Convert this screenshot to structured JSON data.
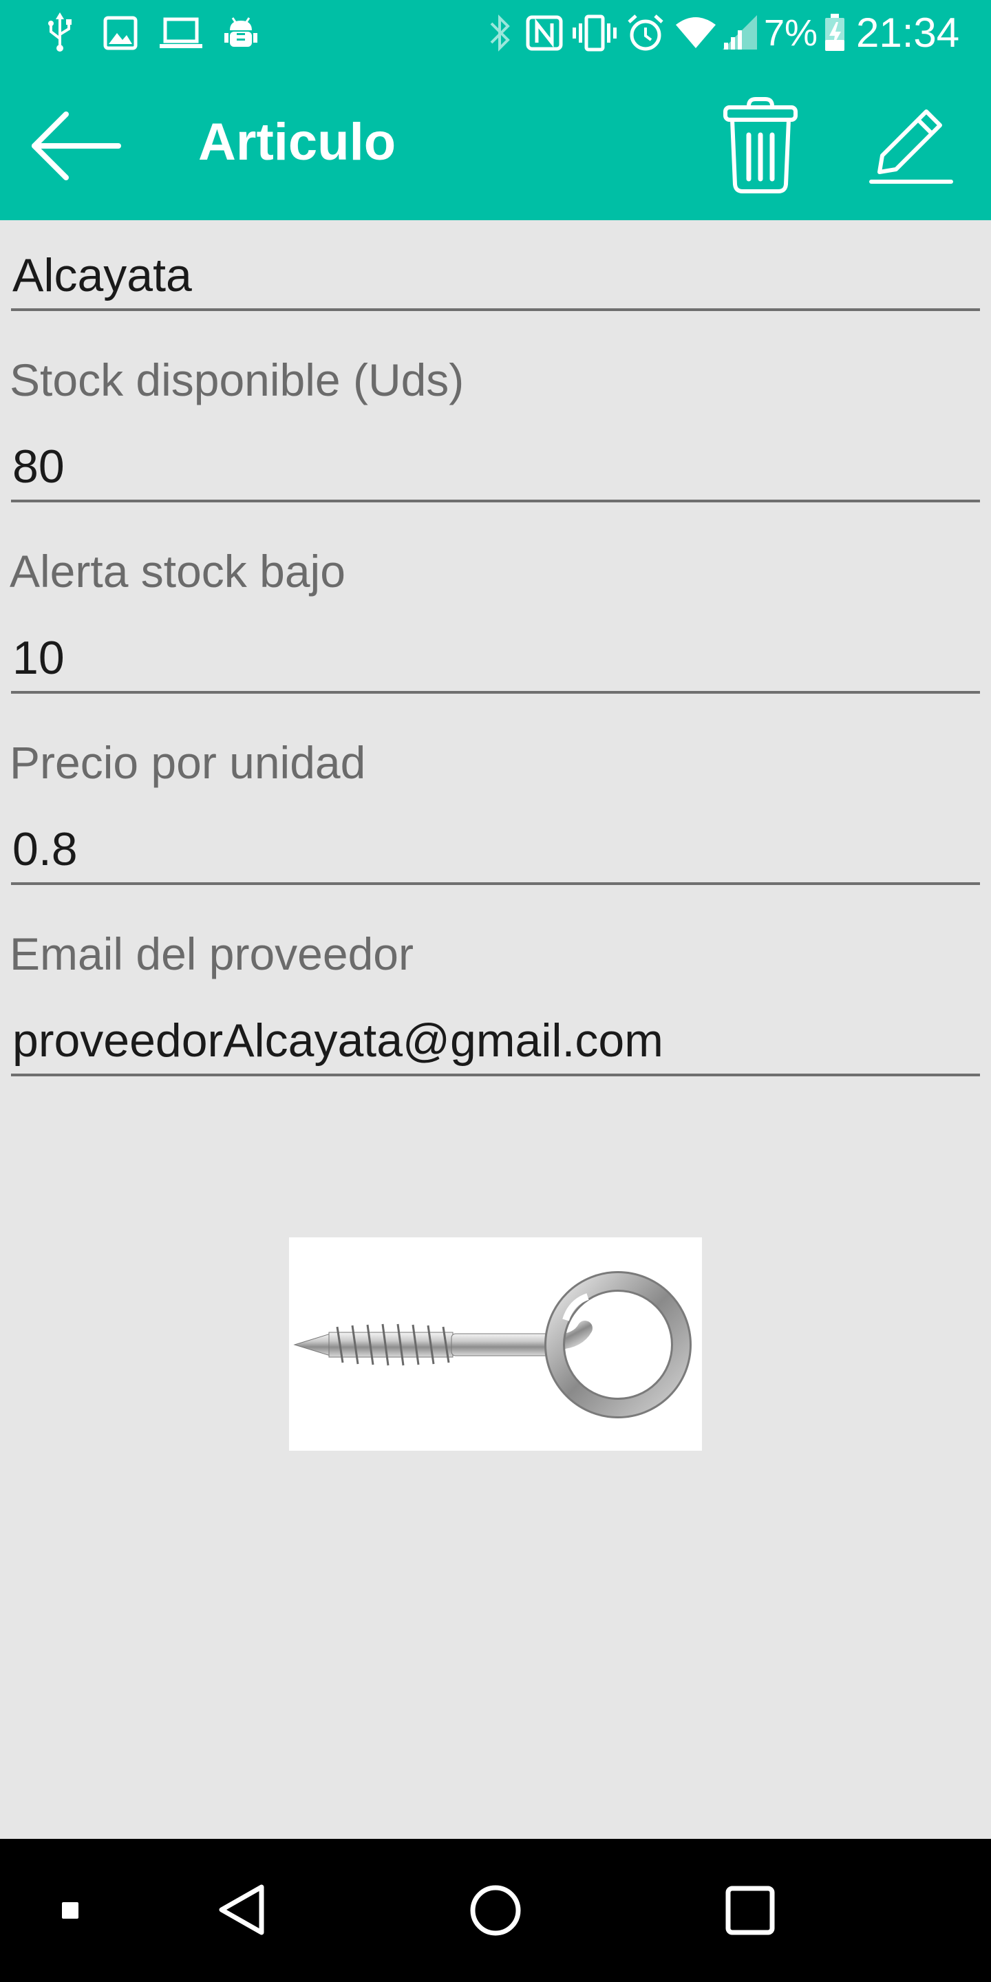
{
  "status_bar": {
    "battery_percent": "7%",
    "clock": "21:34",
    "left_icons": [
      "usb-icon",
      "image-icon",
      "laptop-icon",
      "android-debug-icon"
    ],
    "right_icons": [
      "bluetooth-icon",
      "nfc-icon",
      "vibrate-icon",
      "alarm-icon",
      "wifi-icon",
      "signal-icon",
      "battery-charging-icon"
    ]
  },
  "toolbar": {
    "title": "Articulo",
    "back_icon": "arrow-back-icon",
    "delete_icon": "trash-icon",
    "edit_icon": "pencil-icon"
  },
  "form": {
    "name": {
      "value": "Alcayata"
    },
    "stock": {
      "label": "Stock disponible (Uds)",
      "value": "80"
    },
    "low_stock_alert": {
      "label": "Alerta stock bajo",
      "value": "10"
    },
    "unit_price": {
      "label": "Precio por unidad",
      "value": "0.8"
    },
    "supplier_email": {
      "label": "Email del proveedor",
      "value": "proveedorAlcayata@gmail.com"
    }
  },
  "product_image": {
    "subject": "screw-eye-hook"
  },
  "nav_bar": {
    "icons": [
      "recents-dot-icon",
      "back-triangle-icon",
      "home-circle-icon",
      "overview-square-icon"
    ]
  },
  "colors": {
    "accent": "#00bfa5",
    "background": "#e6e6e6",
    "nav_bar": "#000000"
  }
}
